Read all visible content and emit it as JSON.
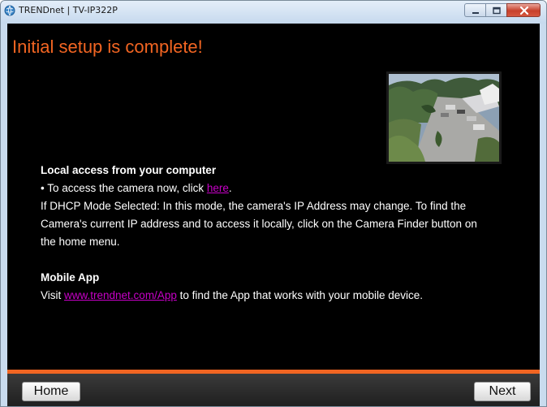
{
  "window": {
    "title": "TRENDnet | TV-IP322P",
    "icon": "trendnet-globe-icon"
  },
  "main": {
    "heading": "Initial setup is complete!",
    "local_access": {
      "title": "Local access from your computer",
      "bullet_prefix": "• To access the camera now, click ",
      "bullet_link": "here",
      "bullet_suffix": ".",
      "dhcp_lines": [
        "If DHCP Mode Selected: In this mode, the camera's IP Address may change. To find the",
        "Camera's current IP address and to access it locally, click on the Camera Finder button on",
        "the home menu."
      ]
    },
    "mobile_app": {
      "title": "Mobile App",
      "prefix": "Visit ",
      "link": "www.trendnet.com/App",
      "suffix": " to find the App that works with your mobile device."
    }
  },
  "footer": {
    "home_label": "Home",
    "next_label": "Next"
  },
  "colors": {
    "accent_orange": "#f26522",
    "link_magenta": "#c800c8",
    "background": "#000000"
  }
}
